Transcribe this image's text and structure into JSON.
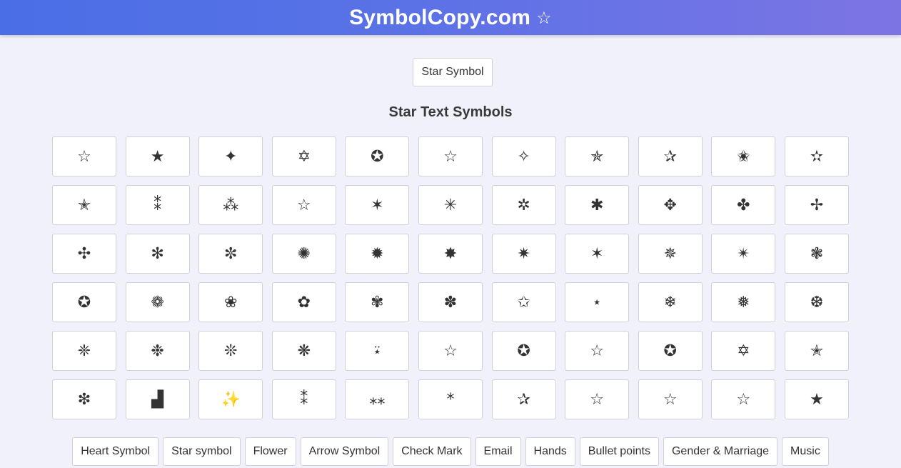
{
  "header": {
    "title": "SymbolCopy.com",
    "star": "☆"
  },
  "top_button": {
    "label": "Star Symbol"
  },
  "section": {
    "title": "Star Text Symbols"
  },
  "symbols": [
    "☆",
    "★",
    "✦",
    "✡",
    "✪",
    "☆",
    "✧",
    "✯",
    "✰",
    "✬",
    "✫",
    "✭",
    "⁑",
    "⁂",
    "☆",
    "✶",
    "✳",
    "✲",
    "✱",
    "✥",
    "✤",
    "✢",
    "✣",
    "✻",
    "✼",
    "✺",
    "✹",
    "✸",
    "✷",
    "✶",
    "✵",
    "✴",
    "❃",
    "✪",
    "❁",
    "❀",
    "✿",
    "✾",
    "✽",
    "✩",
    "⋆",
    "❄",
    "❅",
    "❆",
    "❈",
    "❉",
    "❊",
    "❋",
    "⍣",
    "☆",
    "✪",
    "☆",
    "✪",
    "✡",
    "✭",
    "❇",
    "▟",
    "✨",
    "⁑",
    "⁎⁎",
    "*",
    "✰",
    "☆",
    "☆",
    "☆",
    "★"
  ],
  "bottom_nav": [
    "Heart Symbol",
    "Star symbol",
    "Flower",
    "Arrow Symbol",
    "Check Mark",
    "Email",
    "Hands",
    "Bullet points",
    "Gender & Marriage",
    "Music"
  ]
}
